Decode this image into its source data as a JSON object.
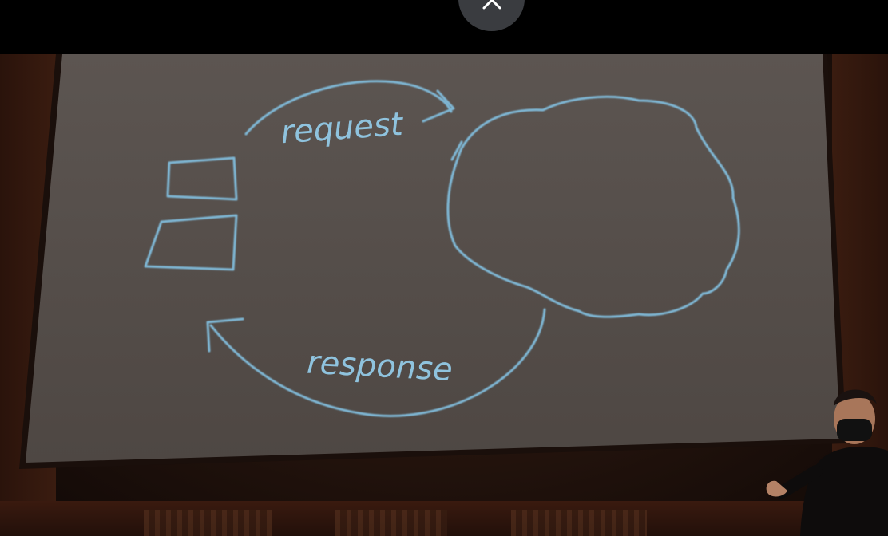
{
  "overlay": {
    "close_icon": "close-icon"
  },
  "slide": {
    "request_label": "request",
    "response_label": "response",
    "client_icon": "client-boxes",
    "server_icon": "cloud-shape",
    "ink_color": "#7fb8d6"
  },
  "colors": {
    "screen": "#5a514c",
    "background": "#000000",
    "close_button": "#3a3c40"
  }
}
